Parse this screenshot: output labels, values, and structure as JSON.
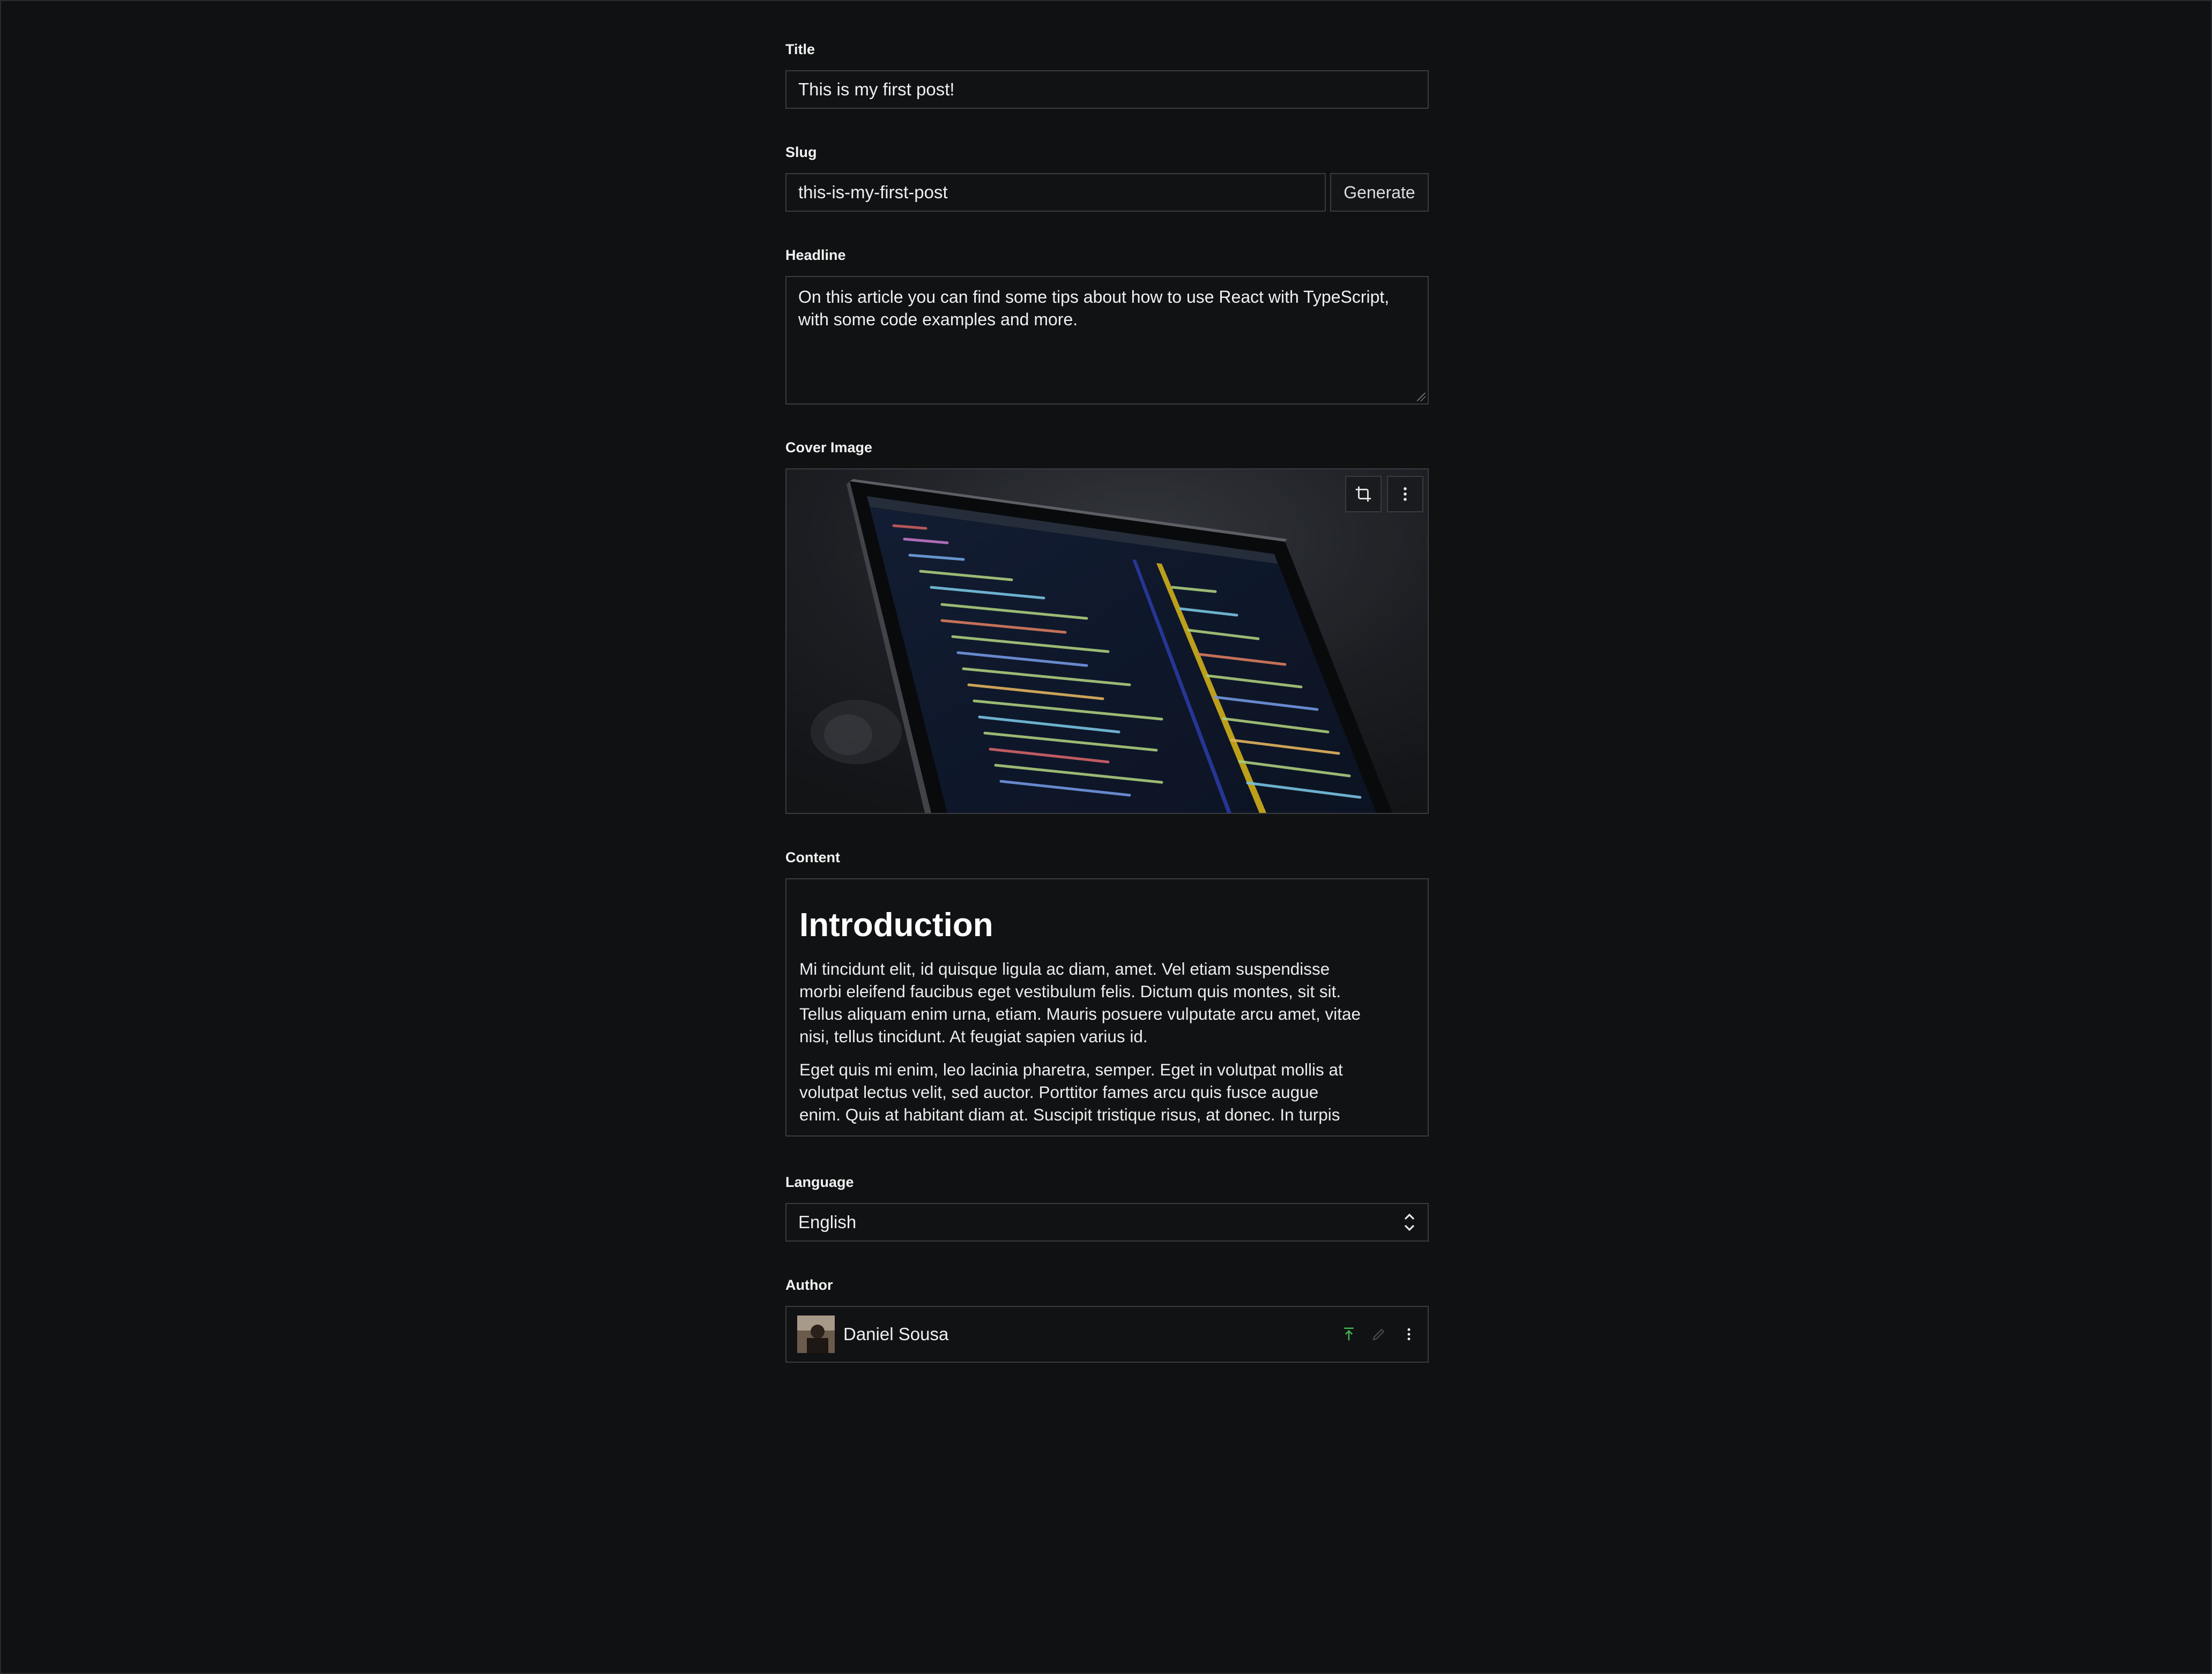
{
  "form": {
    "title": {
      "label": "Title",
      "value": "This is my first post!"
    },
    "slug": {
      "label": "Slug",
      "value": "this-is-my-first-post",
      "generate_label": "Generate"
    },
    "headline": {
      "label": "Headline",
      "line1": "On this article you can find some tips about how to use React with TypeScript,",
      "line2": "with some code examples and more."
    },
    "cover_image": {
      "label": "Cover Image",
      "icons": [
        "crop-icon",
        "more-vertical-icon"
      ]
    },
    "content": {
      "label": "Content",
      "heading": "Introduction",
      "p1_lines": [
        "Mi tincidunt elit, id quisque ligula ac diam, amet. Vel etiam suspendisse",
        "morbi eleifend faucibus eget vestibulum felis. Dictum quis montes, sit sit.",
        "Tellus aliquam enim urna, etiam. Mauris posuere vulputate arcu amet, vitae",
        "nisi, tellus tincidunt. At feugiat sapien varius id."
      ],
      "p2_lines": [
        "Eget quis mi enim, leo lacinia pharetra, semper. Eget in volutpat mollis at",
        "volutpat lectus velit, sed auctor. Porttitor fames arcu quis fusce augue",
        "enim. Quis at habitant diam at. Suscipit tristique risus, at donec. In turpis"
      ]
    },
    "language": {
      "label": "Language",
      "value": "English"
    },
    "author": {
      "label": "Author",
      "name": "Daniel Sousa",
      "icons": [
        "publish-icon",
        "edit-icon",
        "more-vertical-icon"
      ],
      "publish_color": "#3fb950"
    }
  }
}
